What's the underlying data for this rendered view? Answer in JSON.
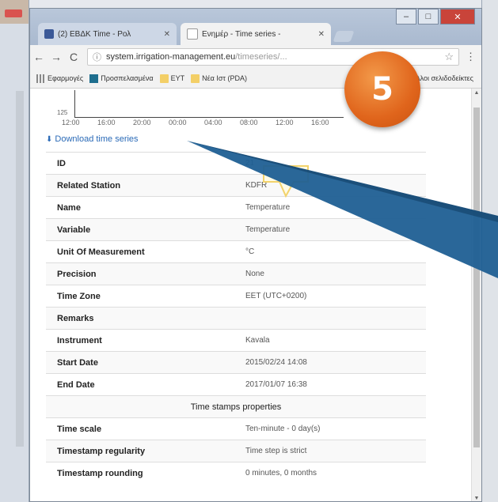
{
  "browser": {
    "tabs": [
      {
        "label": "(2) ΕΒΔΚ Time - Ρολ"
      },
      {
        "label": "Ενημέρ - Time series -"
      }
    ],
    "url_main": "system.irrigation-management.eu",
    "url_rest": "/timeseries/...",
    "bookmarks": [
      {
        "label": "Εφαρμογές"
      },
      {
        "label": "Προσπελασμένα"
      },
      {
        "label": "EΥΤ"
      },
      {
        "label": "Νέα Ιστ (PDA)"
      }
    ],
    "bookmarks_other": "Άλλοι σελιδοδείκτες"
  },
  "chart": {
    "y_label": "125",
    "ticks": [
      "12:00",
      "16:00",
      "20:00",
      "00:00",
      "04:00",
      "08:00",
      "12:00",
      "16:00"
    ]
  },
  "download_link": "Download time series",
  "properties": [
    {
      "key": "ID",
      "value": "21"
    },
    {
      "key": "Related Station",
      "value": "KDFR"
    },
    {
      "key": "Name",
      "value": "Temperature"
    },
    {
      "key": "Variable",
      "value": "Temperature"
    },
    {
      "key": "Unit Of Measurement",
      "value": "°C"
    },
    {
      "key": "Precision",
      "value": "None"
    },
    {
      "key": "Time Zone",
      "value": "EET (UTC+0200)"
    },
    {
      "key": "Remarks",
      "value": ""
    },
    {
      "key": "Instrument",
      "value": "Kavala"
    },
    {
      "key": "Start Date",
      "value": "2015/02/24 14:08"
    },
    {
      "key": "End Date",
      "value": "2017/01/07 16:38"
    }
  ],
  "section_title": "Time stamps properties",
  "timestamp_properties": [
    {
      "key": "Time scale",
      "value": "Ten-minute - 0 day(s)"
    },
    {
      "key": "Timestamp regularity",
      "value": "Time step is strict"
    },
    {
      "key": "Timestamp rounding",
      "value": "0 minutes, 0 months"
    }
  ],
  "step_number": "5",
  "colors": {
    "badge": "#e0651c",
    "pointer": "#1f5f94",
    "link": "#2a6ab7"
  }
}
